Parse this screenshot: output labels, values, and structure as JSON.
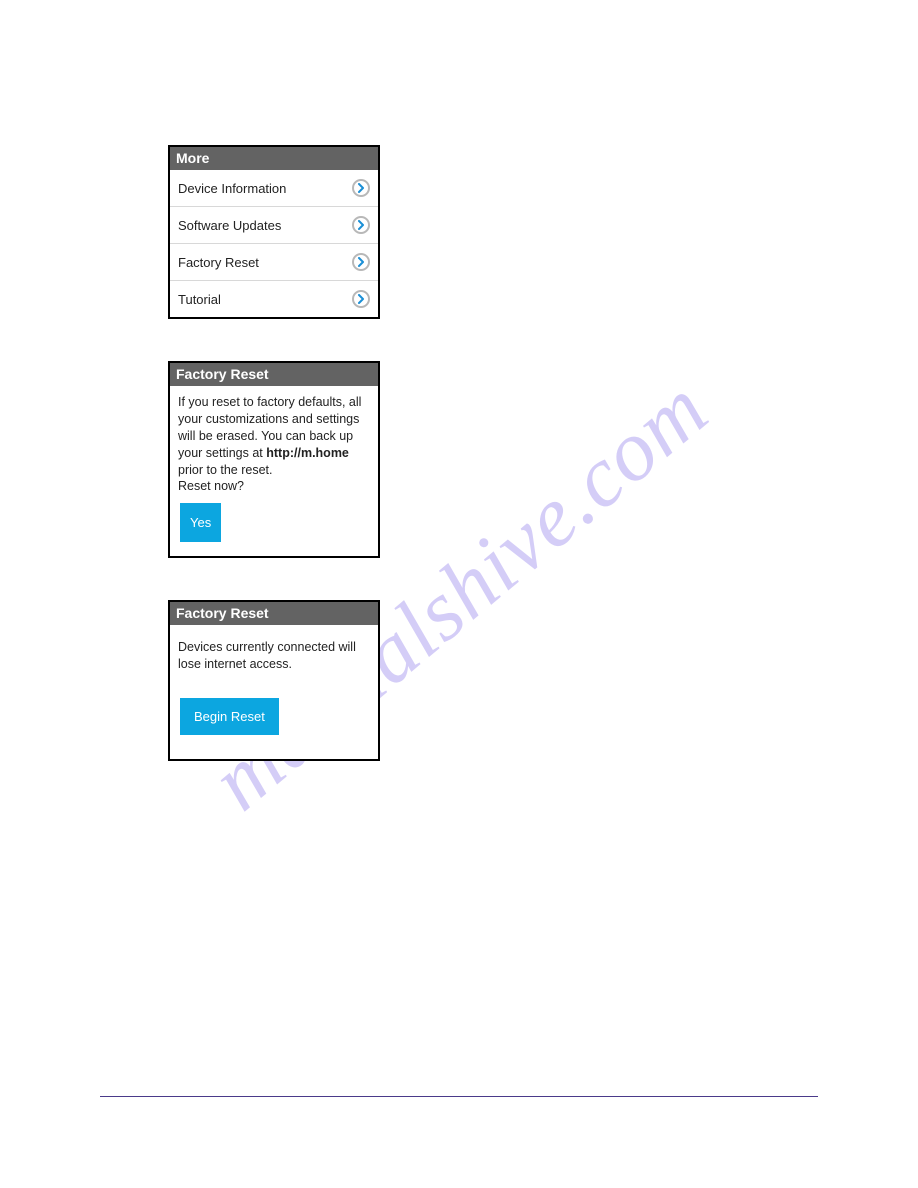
{
  "watermark": "manualshive.com",
  "panel_more": {
    "title": "More",
    "items": [
      {
        "label": "Device Information"
      },
      {
        "label": "Software Updates"
      },
      {
        "label": "Factory Reset"
      },
      {
        "label": "Tutorial"
      }
    ]
  },
  "panel_reset1": {
    "title": "Factory Reset",
    "body_line1": "If you reset to factory defaults, all your customizations and settings will be erased. You can back up your settings at ",
    "body_bold": "http://m.home",
    "body_line2": " prior to the reset.",
    "body_line3": "Reset now?",
    "button": "Yes"
  },
  "panel_reset2": {
    "title": "Factory Reset",
    "body": "Devices currently connected will lose internet access.",
    "button": "Begin Reset"
  }
}
